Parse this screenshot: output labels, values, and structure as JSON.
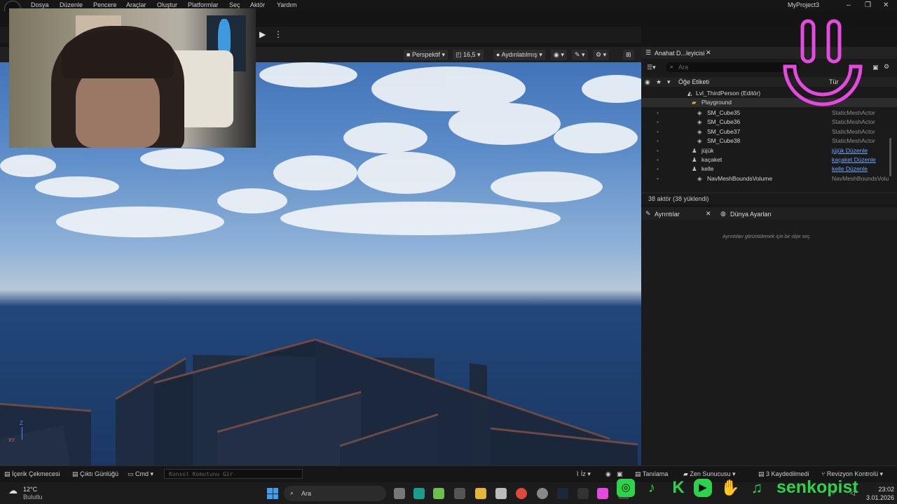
{
  "menu": {
    "items": [
      "Dosya",
      "Düzenle",
      "Pencere",
      "Araçlar",
      "Oluştur",
      "Platformlar",
      "Seç",
      "Aktör",
      "Yardım"
    ],
    "project": "MyProject3"
  },
  "viewport": {
    "perspective": "Perspektif",
    "fov": "16,5",
    "lighting": "Aydınlatılmış",
    "axis_z": "Z",
    "axis_xy": "XY"
  },
  "outliner": {
    "tab_title": "Anahat D...leyicisi",
    "search_placeholder": "Ara",
    "col_label": "Öğe Etiketi",
    "col_type": "Tür",
    "level": "Lvl_ThirdPerson (Editör)",
    "folder": "Playground",
    "rows": [
      {
        "name": "SM_Cube35",
        "type": "StaticMeshActor",
        "link": false
      },
      {
        "name": "SM_Cube36",
        "type": "StaticMeshActor",
        "link": false
      },
      {
        "name": "SM_Cube37",
        "type": "StaticMeshActor",
        "link": false
      },
      {
        "name": "SM_Cube38",
        "type": "StaticMeshActor",
        "link": false
      },
      {
        "name": "jüjük",
        "type": "jüjük Düzenle",
        "link": true
      },
      {
        "name": "kaçaket",
        "type": "kaçaket Düzenle",
        "link": true
      },
      {
        "name": "kelle",
        "type": "kelle Düzenle",
        "link": true
      },
      {
        "name": "NavMeshBoundsVolume",
        "type": "NavMeshBoundsVolu",
        "link": false
      }
    ],
    "status": "38 aktör (38 yüklendi)"
  },
  "details": {
    "tab_details": "Ayrıntılar",
    "tab_world": "Dünya Ayarları",
    "empty_msg": "Ayrıntıları görüntülemek için bir obje seç."
  },
  "bottombar": {
    "content_drawer": "İçerik Çekmecesi",
    "output_log": "Çıktı Günlüğü",
    "cmd": "Cmd",
    "console_placeholder": "Konsol Komutunu Gir",
    "trace": "İz",
    "diagnose": "Tanılama",
    "zen": "Zen Sunucusu",
    "saved": "3 Kaydedilmedi",
    "revision": "Revizyon Kontrolü"
  },
  "taskbar": {
    "temp": "12°C",
    "weather": "Bulutlu",
    "search": "Ara",
    "time": "23:02",
    "date": "3.01.2026"
  },
  "overlay": {
    "brand": "senkopist",
    "accent": "#e54ae0",
    "green": "#2dd34a"
  }
}
